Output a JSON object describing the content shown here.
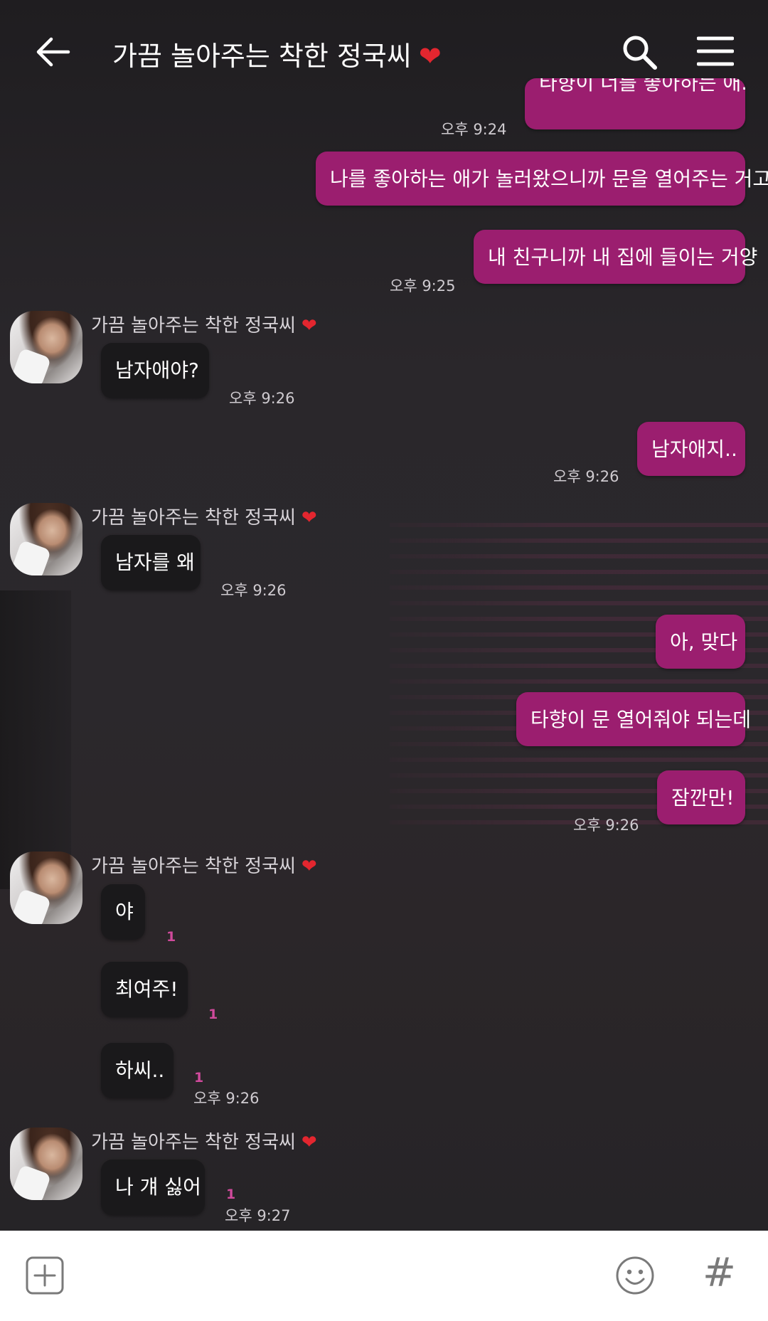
{
  "header": {
    "title": "가끔 놀아주는 착한 정국씨",
    "title_emoji": "❤️"
  },
  "messages": {
    "m0": {
      "text": "타향이 너를 좋아하는 애.",
      "time": "오후 9:24"
    },
    "m1": {
      "text": "나를 좋아하는 애가 놀러왔으니까 문을 열어주는 거고"
    },
    "m2": {
      "text": "내 친구니까 내 집에 들이는 거양",
      "time": "오후 9:25"
    },
    "g1": {
      "sender": "가끔 놀아주는 착한 정국씨",
      "text": "남자애야?",
      "time": "오후 9:26"
    },
    "m3": {
      "text": "남자애지..",
      "time": "오후 9:26"
    },
    "g2": {
      "sender": "가끔 놀아주는 착한 정국씨",
      "text": "남자를 왜",
      "time": "오후 9:26"
    },
    "m4": {
      "text": "아, 맞다"
    },
    "m5": {
      "text": "타향이 문 열어줘야 되는데"
    },
    "m6": {
      "text": "잠깐만!",
      "time": "오후 9:26"
    },
    "g3": {
      "sender": "가끔 놀아주는 착한 정국씨",
      "items": [
        {
          "text": "야",
          "unread": "1"
        },
        {
          "text": "최여주!",
          "unread": "1"
        },
        {
          "text": "하씨..",
          "unread": "1"
        }
      ],
      "time": "오후 9:26"
    },
    "g4": {
      "sender": "가끔 놀아주는 착한 정국씨",
      "text": "나 걔 싫어",
      "unread": "1",
      "time": "오후 9:27"
    }
  },
  "heart": "❤",
  "bottom": {
    "hash": "#"
  }
}
